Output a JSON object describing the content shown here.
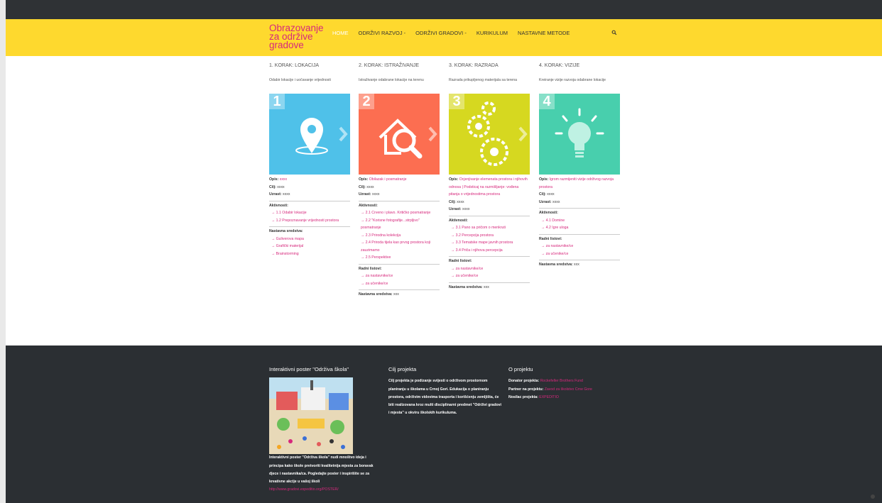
{
  "brand": {
    "title": "Obrazovanje za održive gradove",
    "accent": "#d6287c",
    "header_bg": "#fed92e"
  },
  "nav": {
    "items": [
      {
        "label": "HOME",
        "active": true
      },
      {
        "label": "ODRŽIVI RAZVOJ -",
        "active": false
      },
      {
        "label": "ODRŽIVI GRADOVI -",
        "active": false
      },
      {
        "label": "KURIKULUM",
        "active": false
      },
      {
        "label": "NASTAVNE METODE",
        "active": false
      }
    ],
    "search_icon": "search-icon"
  },
  "steps": [
    {
      "title": "1. KORAK: LOKACIJA",
      "subtitle": "Odabir lokacije i uočavanje vrijednosti",
      "number": "1",
      "color": "#4fc1e9",
      "icon": "location-pin-icon",
      "opis_label": "Opis:",
      "opis": "xxxx",
      "cilj_label": "Cilj:",
      "cilj": "xxxx",
      "uzrast_label": "Uzrast:",
      "uzrast": "xxxx",
      "aktivnosti_label": "Aktivnosti:",
      "aktivnosti": [
        "→ 1.1 Odabir lokacije",
        "→ 1.2 Prepoznavanje vrijednosti prostora"
      ],
      "nastavna_label": "Nastavna sredstva:",
      "nastavna": [
        "→ Guliverova mapa",
        "→ Grafički materijal",
        "→ Brainstorming"
      ]
    },
    {
      "title": "2. KORAK: ISTRAŽIVANJE",
      "subtitle": "Istraživanje odabrane lokacije na terenu",
      "number": "2",
      "color": "#fc6e51",
      "icon": "house-magnifier-icon",
      "opis_label": "Opis:",
      "opis": "Obilazak i posmatranje",
      "cilj_label": "Cilj:",
      "cilj": "xxxx",
      "uzrast_label": "Uzrast:",
      "uzrast": "xxxx",
      "aktivnosti_label": "Aktivnosti:",
      "aktivnosti": [
        "→ 2.1 Crveno i plavo. Kritičko posmatranje",
        "→ 2.2 \"Korisne fotografije...strpljivo\" posmatranje",
        "→ 2.3 Prirodna kolekcija",
        "→ 2.4 Priroda tijela kao prvog prostora koji zauzimamo",
        "→ 2.5 Perspektive"
      ],
      "radni_label": "Radni listovi:",
      "radni": [
        "→ za nastavnike/ce",
        "→ za učenike/ce"
      ],
      "nastavna_label": "Nastavna sredstva:",
      "nastavna_value": "xxx"
    },
    {
      "title": "3. KORAK: RAZRADA",
      "subtitle": "Razrada prikupljenog materijala sa terena",
      "number": "3",
      "color": "#d6d820",
      "icon": "gears-icon",
      "opis_label": "Opis:",
      "opis": "Ocjenjivanje elemenata prostora i njihovih odnosa | Podsticaj na razmišljanje: vođena pitanja o vrijednostima prostora",
      "cilj_label": "Cilj:",
      "cilj": "xxxx",
      "uzrast_label": "Uzrast:",
      "uzrast": "xxxx",
      "aktivnosti_label": "Aktivnosti:",
      "aktivnosti": [
        "→ 3.1 Pano sa pričom o menkruti",
        "→ 3.2 Percepcija prostora",
        "→ 3.3 Tematske mape javnih prostora",
        "→ 3.4 Priča i njihova percepcija"
      ],
      "radni_label": "Radni listovi:",
      "radni": [
        "→ za nastavnike/ce",
        "→ za učenike/ce"
      ],
      "nastavna_label": "Nastavna sredstva:",
      "nastavna_value": "xxx"
    },
    {
      "title": "4. KORAK: VIZIJE",
      "subtitle": "Kreiranje vizije razvoja odabrane lokacije",
      "number": "4",
      "color": "#48cfad",
      "icon": "lightbulb-icon",
      "opis_label": "Opis:",
      "opis": "Igrom razmijeniti vizije održivog razvoja prostora",
      "cilj_label": "Cilj:",
      "cilj": "xxxx",
      "uzrast_label": "Uzrast:",
      "uzrast": "xxxx",
      "aktivnosti_label": "Aktivnosti:",
      "aktivnosti": [
        "→ 4.1 Domine",
        "→ 4.2 Igre uloga"
      ],
      "radni_label": "Radni listovi:",
      "radni": [
        "→ za nastavnike/ce",
        "→ za učenike/ce"
      ],
      "nastavna_label": "Nastavna sredstva:",
      "nastavna_value": "xxx"
    }
  ],
  "footer": {
    "poster": {
      "heading": "Interaktivni poster \"Održiva škola\"",
      "text": "Interaktivni poster \"Održiva škola\" nudi mnoštvo ideja i principa kako škole pretvoriti kvalitetnija mjesta za boravak djece i nastavnika/ca. Pogledajte poster i inspirišite se za kreativne akcije u vašoj",
      "link_label": "školi",
      "link": "http://www.gradovi.expeditio.org/POSTER/"
    },
    "cilj": {
      "heading": "Cilj projekta",
      "text": "Cilj projekta je podizanje svijesti o održivom prostornom planiranju u školama u Crnoj Gori. Edukacija o planiranju prostora, održivim vidovima trasporta i korišćenju zemljišta, će biti realizovana kroz multi disciplinarni predmet \"Održivi gradovi i mjesta\" u okviru školskih kurikuluma."
    },
    "o_projektu": {
      "heading": "O projektu",
      "rows": [
        {
          "label": "Donator projekta:",
          "value": "Rockefeller Brothers Fund"
        },
        {
          "label": "Partner na projektu:",
          "value": "Zavod za školstvo Crne Gore"
        },
        {
          "label": "Nosilac projekta:",
          "value": "EXPEDITIO"
        }
      ]
    }
  }
}
